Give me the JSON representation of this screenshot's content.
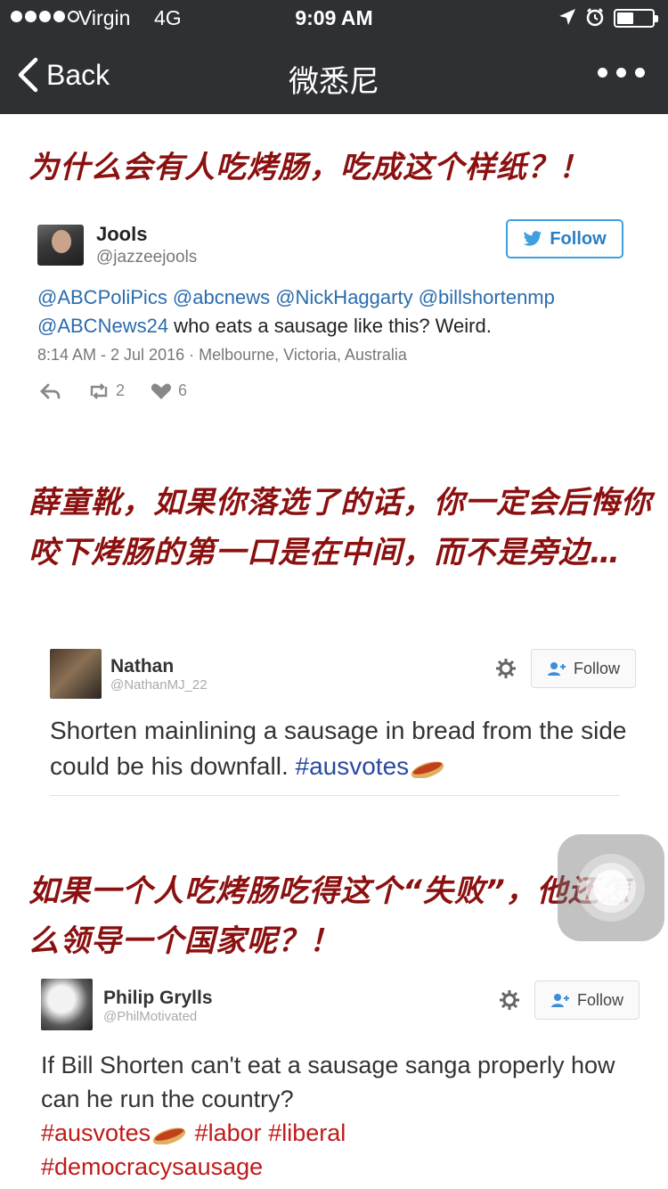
{
  "status_bar": {
    "carrier": "Virgin",
    "network": "4G",
    "time": "9:09 AM",
    "signal_bars_filled": 4,
    "signal_bars_total": 5,
    "battery_level": 0.35
  },
  "nav": {
    "back_label": "Back",
    "title": "微悉尼",
    "more_icon": "ellipsis-icon"
  },
  "sections": [
    {
      "headline": "为什么会有人吃烤肠，吃成这个样纸？！",
      "tweet": {
        "name": "Jools",
        "handle": "@jazzeejools",
        "follow_label": "Follow",
        "mentions_line1": "@ABCPoliPics @abcnews @NickHaggarty @billshortenmp",
        "mention_line2": "@ABCNews24",
        "text_line2": " who eats a sausage like this? Weird.",
        "meta": "8:14 AM - 2 Jul 2016 · Melbourne, Victoria, Australia",
        "retweets": "2",
        "likes": "6"
      }
    },
    {
      "headline": "薛童靴，如果你落选了的话，你一定会后悔你咬下烤肠的第一口是在中间，而不是旁边…",
      "tweet": {
        "name": "Nathan",
        "handle": "@NathanMJ_22",
        "follow_label": "Follow",
        "text": "Shorten mainlining a sausage in bread from the side could be his downfall. ",
        "hashtag": "#ausvotes"
      }
    },
    {
      "headline": "如果一个人吃烤肠吃得这个“失败”，他还怎么领导一个国家呢？！",
      "tweet": {
        "name": "Philip Grylls",
        "handle": "@PhilMotivated",
        "follow_label": "Follow",
        "text": "If Bill Shorten can't eat a sausage sanga properly how can he run the country?",
        "hashtag1": "#ausvotes",
        "hashtag2": "#labor",
        "hashtag3": "#liberal",
        "hashtag4": "#democracysausage"
      }
    }
  ],
  "colors": {
    "nav_bg": "#2f3033",
    "headline": "#8b1010",
    "twitter_link": "#2a6cad",
    "hashtag_red": "#c01a1a"
  }
}
